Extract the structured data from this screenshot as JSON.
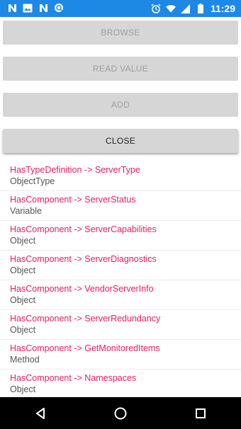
{
  "status_bar": {
    "time": "11:29",
    "left_icons": [
      "n-notification-icon",
      "image-icon",
      "n-notification-icon",
      "search-icon"
    ],
    "right_icons": [
      "alarm-icon",
      "wifi-icon",
      "signal-icon",
      "battery-icon"
    ],
    "background": "#1e88e5"
  },
  "buttons": {
    "browse": "BROWSE",
    "read_value": "READ VALUE",
    "add": "ADD",
    "close": "CLOSE"
  },
  "references": [
    {
      "reference": "HasTypeDefinition -> ServerType",
      "node_class": "ObjectType"
    },
    {
      "reference": "HasComponent -> ServerStatus",
      "node_class": "Variable"
    },
    {
      "reference": "HasComponent -> ServerCapabilities",
      "node_class": "Object"
    },
    {
      "reference": "HasComponent -> ServerDiagnostics",
      "node_class": "Object"
    },
    {
      "reference": "HasComponent -> VendorServerInfo",
      "node_class": "Object"
    },
    {
      "reference": "HasComponent -> ServerRedundancy",
      "node_class": "Object"
    },
    {
      "reference": "HasComponent -> GetMonitoredItems",
      "node_class": "Method"
    },
    {
      "reference": "HasComponent -> Namespaces",
      "node_class": "Object"
    }
  ],
  "nav_bar": {
    "icons": [
      "back-icon",
      "home-icon",
      "recents-icon"
    ]
  },
  "colors": {
    "reference_text": "#e91e63",
    "button_bg": "#d6d6d6"
  }
}
